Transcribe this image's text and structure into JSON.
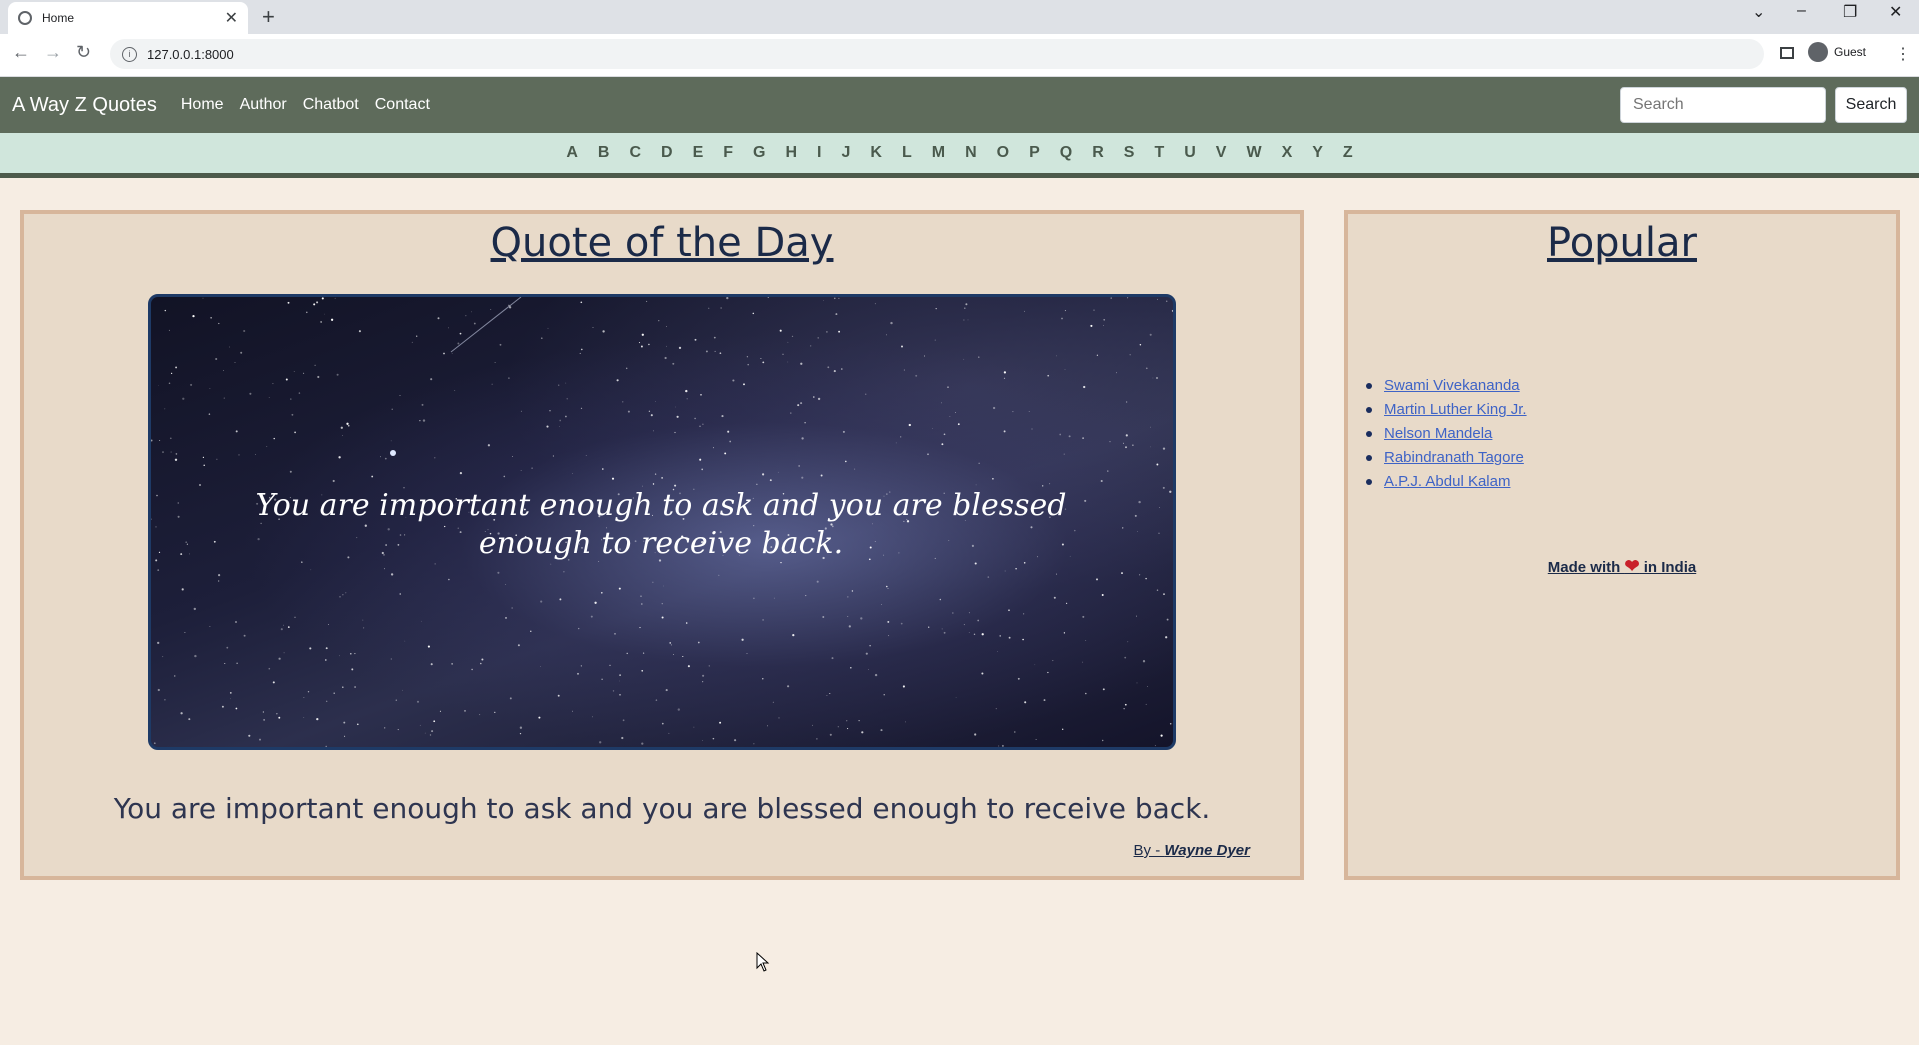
{
  "browser": {
    "tab_title": "Home",
    "url": "127.0.0.1:8000",
    "profile_label": "Guest"
  },
  "site": {
    "brand": "A Way Z Quotes",
    "nav": [
      "Home",
      "Author",
      "Chatbot",
      "Contact"
    ],
    "search": {
      "placeholder": "Search",
      "button_label": "Search"
    },
    "alphabet": [
      "A",
      "B",
      "C",
      "D",
      "E",
      "F",
      "G",
      "H",
      "I",
      "J",
      "K",
      "L",
      "M",
      "N",
      "O",
      "P",
      "Q",
      "R",
      "S",
      "T",
      "U",
      "V",
      "W",
      "X",
      "Y",
      "Z"
    ]
  },
  "quote_of_the_day": {
    "heading": "Quote of the Day",
    "quote": "You are important enough to ask and you are blessed enough to receive back.",
    "by_prefix": "By - ",
    "author": "Wayne Dyer"
  },
  "popular": {
    "heading": "Popular",
    "authors": [
      "Swami Vivekananda",
      "Martin Luther King Jr.",
      "Nelson Mandela",
      "Rabindranath Tagore",
      "A.P.J. Abdul Kalam"
    ],
    "footer_prefix": "Made with ",
    "footer_suffix": " in India"
  },
  "colors": {
    "nav_bg": "#5e6b5b",
    "alpha_bg": "#d0e6dc",
    "card_bg": "#e8dac9",
    "card_border": "#d7b69b",
    "heading": "#1b2a48",
    "link": "#3e63c6",
    "heart": "#c9202a"
  }
}
